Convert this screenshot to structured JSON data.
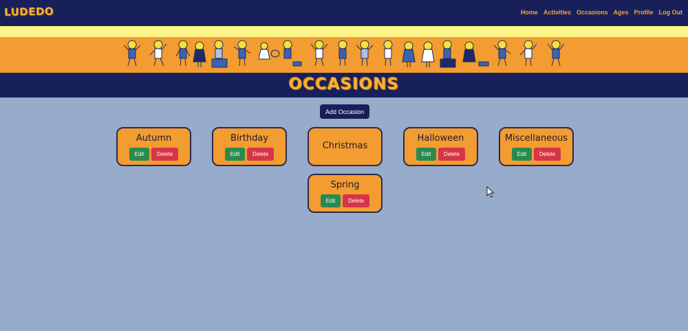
{
  "app": {
    "brand": "LUDEDO"
  },
  "nav": {
    "items": [
      "Home",
      "Activities",
      "Occasions",
      "Ages",
      "Profile",
      "Log Out"
    ]
  },
  "page": {
    "title": "OCCASIONS"
  },
  "actions": {
    "add_label": "Add Occasion"
  },
  "occasions": [
    {
      "name": "Autumn",
      "edit": "Edit",
      "delete": "Delete"
    },
    {
      "name": "Birthday",
      "edit": "Edit",
      "delete": "Delete"
    },
    {
      "name": "Christmas"
    },
    {
      "name": "Halloween",
      "edit": "Edit",
      "delete": "Delete"
    },
    {
      "name": "Miscellaneous",
      "edit": "Edit",
      "delete": "Delete"
    },
    {
      "name": "Spring",
      "edit": "Edit",
      "delete": "Delete"
    }
  ],
  "colors": {
    "navy": "#17205a",
    "orange": "#f29c31",
    "yellow": "#fdf487",
    "background": "#97abcb",
    "edit": "#2a8a4e",
    "delete": "#d63548"
  },
  "icons": {
    "cursor": "mouse-pointer-icon",
    "banner": "children-banner-illustration"
  }
}
